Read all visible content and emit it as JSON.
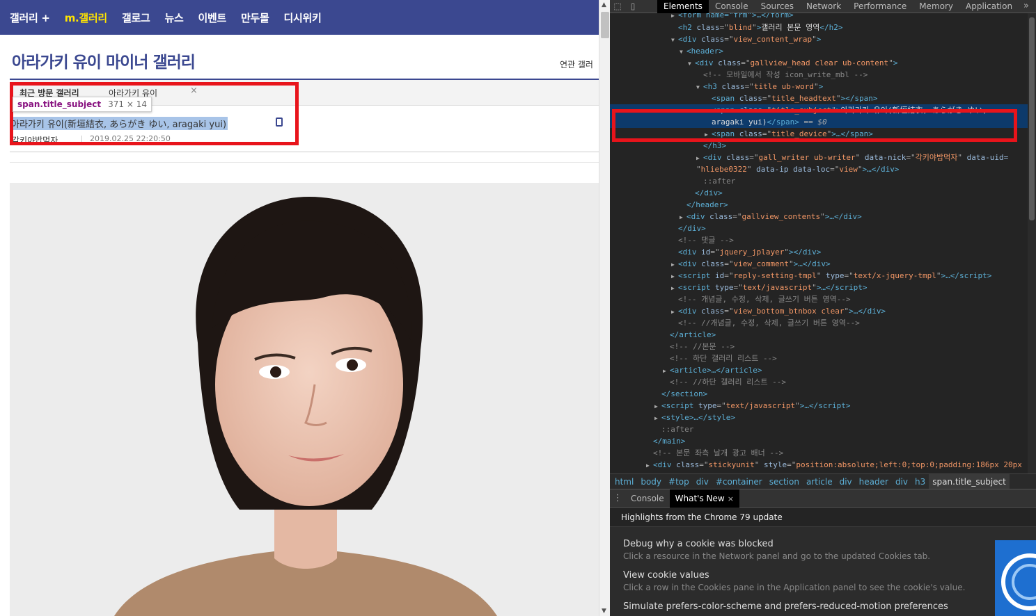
{
  "site": {
    "nav": [
      "갤러리 +",
      "m.갤러리",
      "갤로그",
      "뉴스",
      "이벤트",
      "만두몰",
      "디시위키"
    ],
    "nav_active_index": 1,
    "gallery_title": "아라가키 유이 마이너 갤러리",
    "related_label": "연관 갤러",
    "recent": {
      "label": "최근 방문 갤러리",
      "tab": "아라가키 유이",
      "close": "×"
    },
    "post": {
      "subject": "아라가키 유이(新垣結衣, あらがき ゆい, aragaki yui)",
      "writer": "각키야밥먹자",
      "date": "2019.02.25 22:20:50"
    }
  },
  "inspect_tip": {
    "selector": "span.title_subject",
    "dims": "371 × 14"
  },
  "devtools": {
    "tabs": [
      "Elements",
      "Console",
      "Sources",
      "Network",
      "Performance",
      "Memory",
      "Application"
    ],
    "active_tab": "Elements",
    "more": "»",
    "dom": {
      "l0": "<form name=\"frm\">…</form>",
      "h2_class": "blind",
      "h2_text": "갤러리 본문 영역",
      "wrap_class": "view_content_wrap",
      "head_class": "gallview_head clear ub-content",
      "c_mobile": "<!-- 모바일에서 작성 icon_write_mbl -->",
      "h3_class": "title ub-word",
      "head_span_class": "title_headtext",
      "subject_class": "title_subject",
      "subject_text1": "아라가키 유이(新垣結衣, あらがき ゆい,",
      "subject_text2": "aragaki yui)",
      "dollar": "== $0",
      "device_class": "title_device",
      "writer_class": "gall_writer ub-writer",
      "writer_nick": "각키야밥먹자",
      "writer_uid": "hliebe0322",
      "writer_loc": "view",
      "after": "::after",
      "contents_class": "gallview_contents",
      "c_reply": "<!-- 댓글 -->",
      "jplayer_id": "jquery_jplayer",
      "comment_class": "view_comment",
      "tmpl_id": "reply-setting-tmpl",
      "tmpl_type": "text/x-jquery-tmpl",
      "js_type": "text/javascript",
      "c_btn1": "<!-- 개념글, 수정, 삭제, 글쓰기 버튼 영역-->",
      "bottom_class": "view_bottom_btnbox clear",
      "c_btn2": "<!-- //개념글, 수정, 삭제, 글쓰기 버튼 영역-->",
      "c_body_end": "<!-- //본문 -->",
      "c_list": "<!-- 하단 갤러리 리스트 -->",
      "c_list_end": "<!-- //하단 갤러리 리스트 -->",
      "c_ad": "<!-- 본문 좌측 날개 광고 배너 -->",
      "sticky_class": "stickyunit",
      "sticky_style": "position:absolute;left:0;top:0;padding:186px 20px"
    },
    "breadcrumbs": [
      "html",
      "body",
      "#top",
      "div",
      "#container",
      "section",
      "article",
      "div",
      "header",
      "div",
      "h3",
      "span.title_subject"
    ],
    "drawer": {
      "menu": "⋮",
      "tabs": [
        "Console",
        "What's New"
      ],
      "active": "What's New",
      "close": "×"
    },
    "whats_new": {
      "header": "Highlights from the Chrome 79 update",
      "items": [
        {
          "title": "Debug why a cookie was blocked",
          "desc": "Click a resource in the Network panel and go to the updated Cookies tab."
        },
        {
          "title": "View cookie values",
          "desc": "Click a row in the Cookies pane in the Application panel to see the cookie's value."
        },
        {
          "title": "Simulate prefers-color-scheme and prefers-reduced-motion preferences",
          "desc": ""
        }
      ]
    }
  },
  "colors": {
    "nav_bg": "#3b4890",
    "nav_active": "#ffe400",
    "highlight_red": "#e8141b",
    "selected_row": "#0d3a6b"
  }
}
